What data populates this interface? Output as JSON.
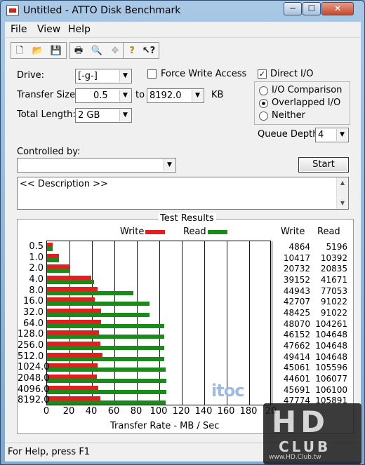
{
  "window": {
    "title": "Untitled - ATTO Disk Benchmark",
    "btn_min": "─",
    "btn_max": "☐",
    "btn_close": "✕"
  },
  "menu": {
    "file": "File",
    "view": "View",
    "help": "Help"
  },
  "toolbar": {
    "icons": [
      "new-icon",
      "open-icon",
      "save-icon",
      "print-icon",
      "print-preview-icon",
      "move-icon",
      "help-icon",
      "context-help-icon"
    ],
    "glyphs": {
      "new": "🗋",
      "open": "📂",
      "save": "💾",
      "print": "🖶",
      "preview": "🔍",
      "move": "✥",
      "help": "?",
      "context_help": "↖?"
    }
  },
  "form": {
    "drive_label": "Drive:",
    "drive_value": "[-g-]",
    "force_write_label": "Force Write Access",
    "force_write_checked": false,
    "direct_io_label": "Direct I/O",
    "direct_io_checked": true,
    "direct_io_mark": "✓",
    "transfer_size_label": "Transfer Size:",
    "transfer_from": "0.5",
    "to_label": "to",
    "transfer_to": "8192.0",
    "kb_label": "KB",
    "total_length_label": "Total Length:",
    "total_length_value": "2 GB",
    "io_comparison_label": "I/O Comparison",
    "overlapped_io_label": "Overlapped I/O",
    "neither_label": "Neither",
    "selected_mode": "Overlapped I/O",
    "queue_depth_label": "Queue Depth:",
    "queue_depth_value": "4",
    "controlled_by_label": "Controlled by:",
    "controlled_by_value": "",
    "start_label": "Start",
    "description_text": "<< Description >>",
    "dropdown_arrow": "▼"
  },
  "results": {
    "title": "Test Results",
    "legend_write": "Write",
    "legend_read": "Read",
    "col_write": "Write",
    "col_read": "Read",
    "write_color": "#e02020",
    "read_color": "#1a8a1a",
    "grid_color": "#0000c8",
    "xlabel": "Transfer Rate - MB / Sec"
  },
  "chart_data": {
    "type": "bar",
    "orientation": "horizontal",
    "title": "Test Results",
    "xlabel": "Transfer Rate - MB / Sec",
    "xlim": [
      0,
      200
    ],
    "xticks": [
      "0",
      "20",
      "40",
      "60",
      "80",
      "100",
      "120",
      "140",
      "160",
      "180",
      "20"
    ],
    "categories": [
      "0.5",
      "1.0",
      "2.0",
      "4.0",
      "8.0",
      "16.0",
      "32.0",
      "64.0",
      "128.0",
      "256.0",
      "512.0",
      "1024.0",
      "2048.0",
      "4096.0",
      "8192.0"
    ],
    "series": [
      {
        "name": "Write",
        "values": [
          4864,
          10417,
          20732,
          39152,
          44943,
          42707,
          48425,
          48070,
          46152,
          47662,
          49414,
          45061,
          44601,
          45691,
          47774
        ]
      },
      {
        "name": "Read",
        "values": [
          5196,
          10392,
          20835,
          41671,
          77053,
          91022,
          91022,
          104261,
          104648,
          104648,
          104648,
          105596,
          106077,
          106100,
          105891
        ]
      }
    ],
    "grid": true,
    "legend": "top-center"
  },
  "status": {
    "text": "For Help, press F1"
  },
  "watermarks": {
    "itoc": "itoc",
    "hd": "HD",
    "club": "CLUB",
    "url": "www.HD.Club.tw"
  }
}
